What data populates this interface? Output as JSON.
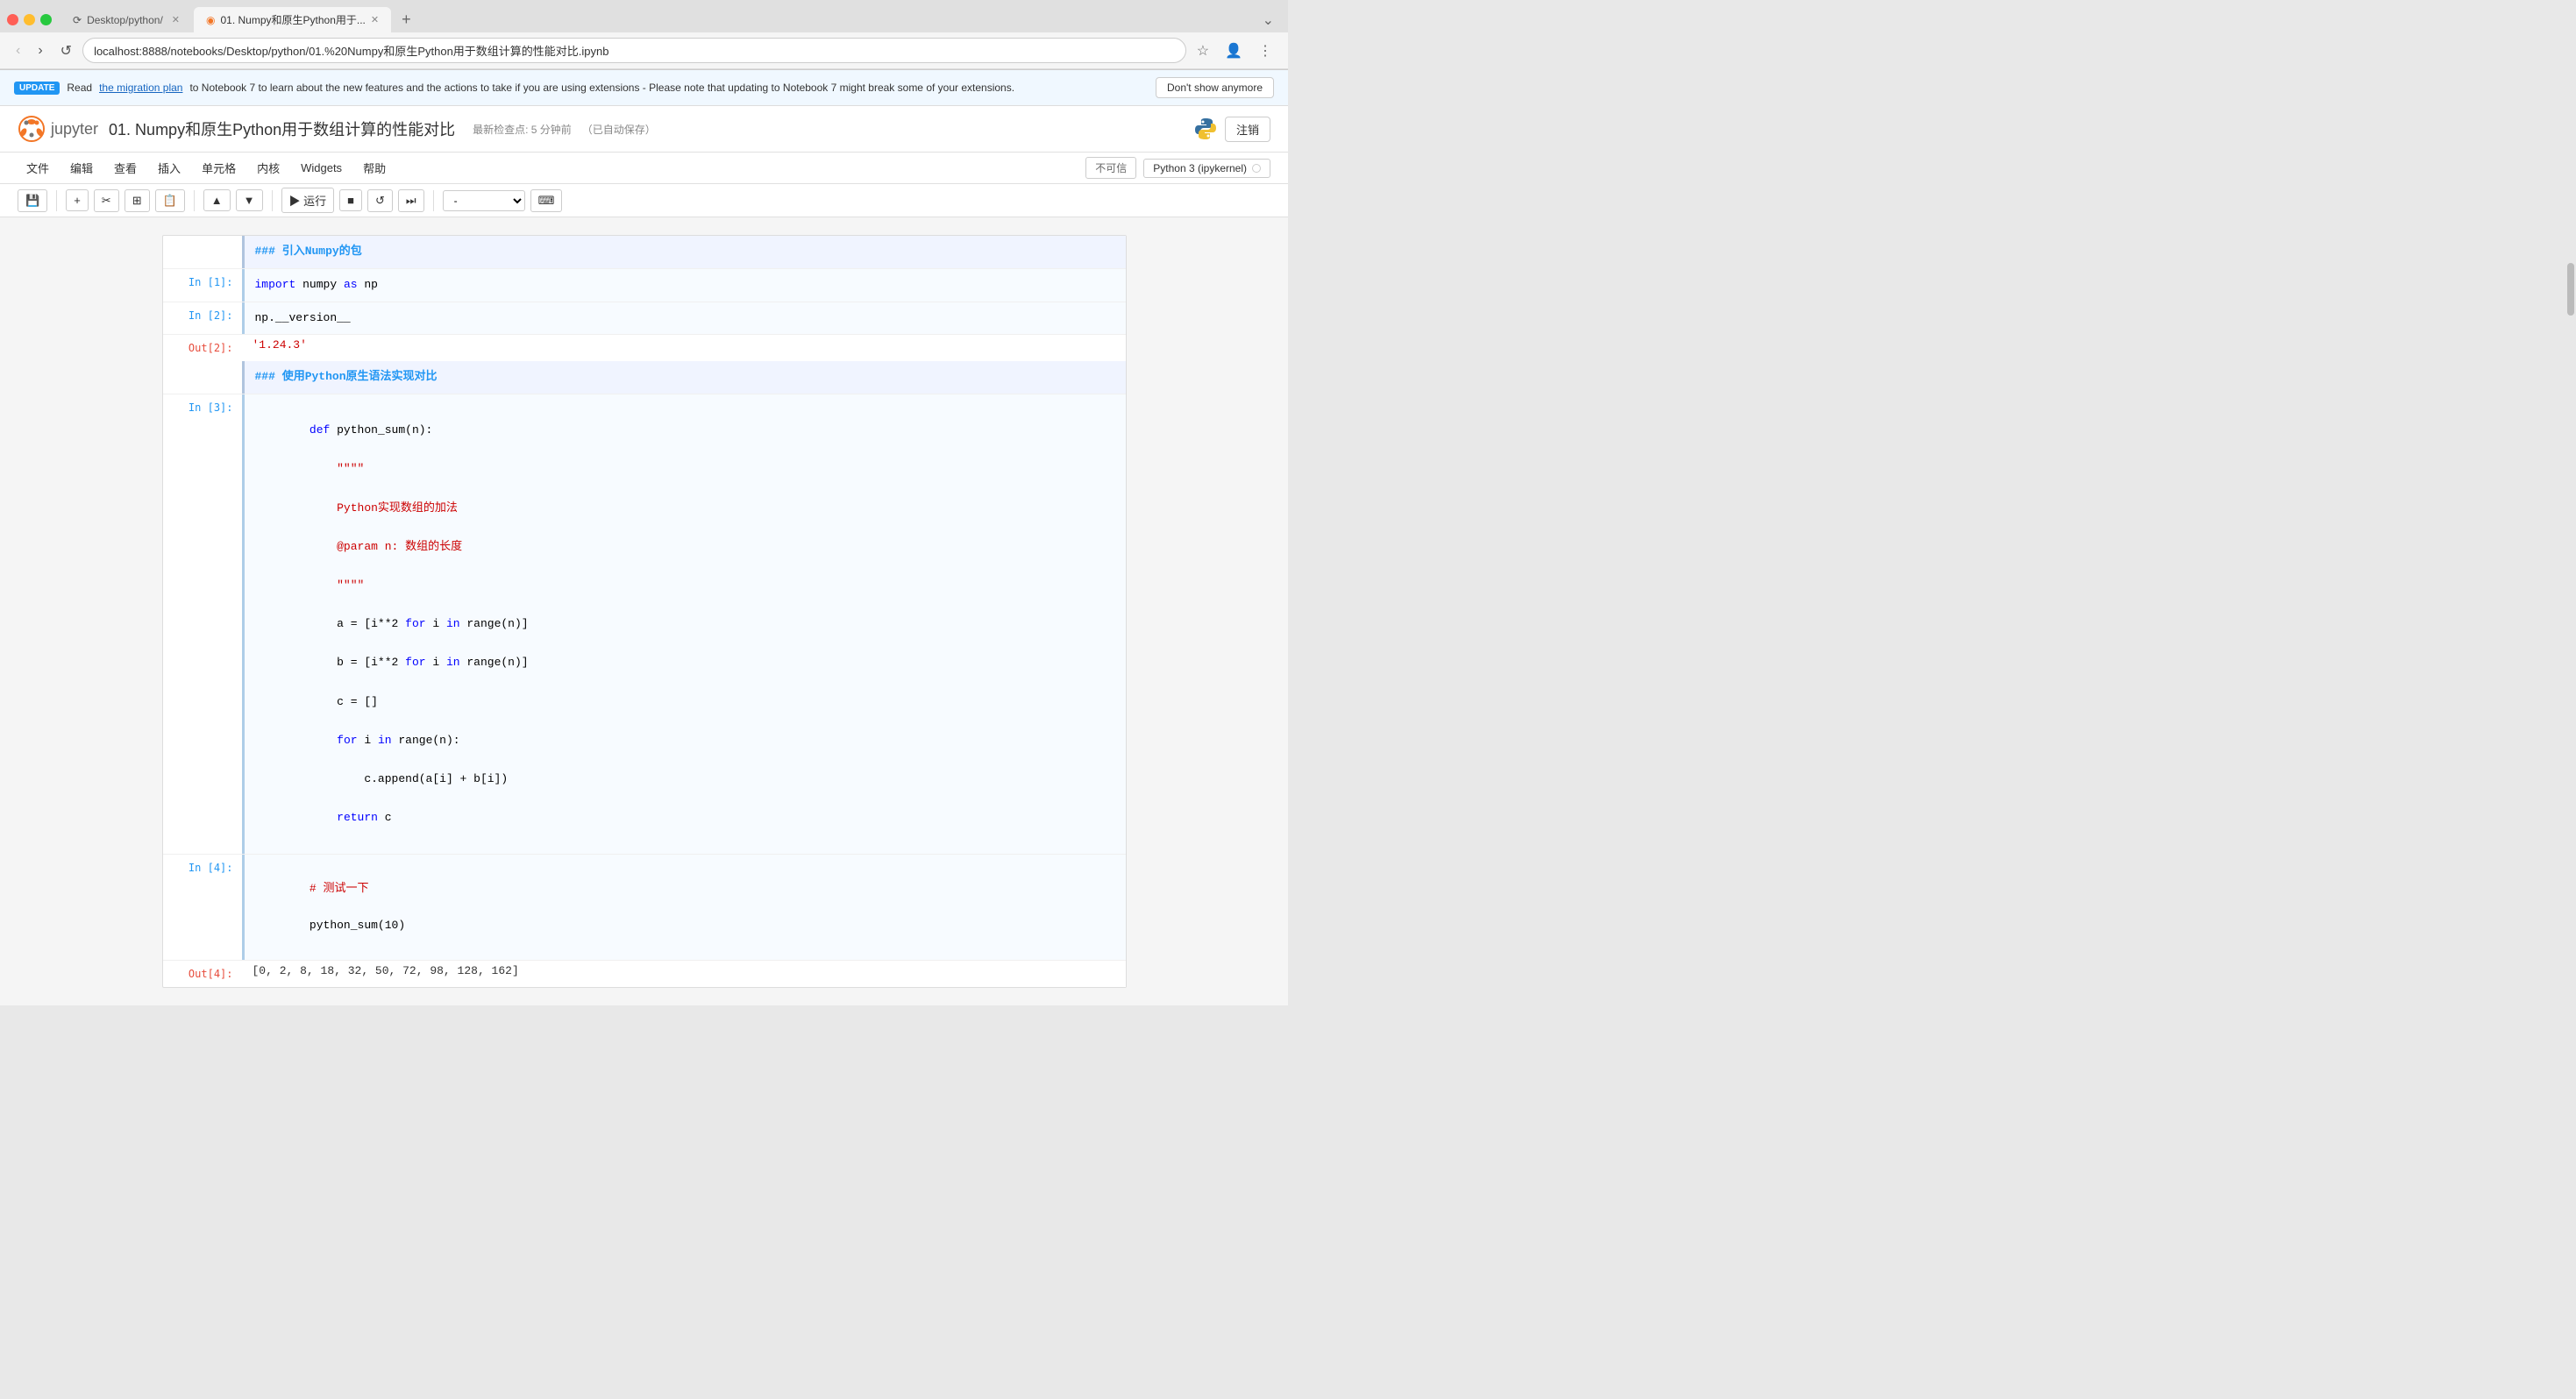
{
  "browser": {
    "tabs": [
      {
        "id": "tab1",
        "label": "Desktop/python/",
        "active": false,
        "loading": true
      },
      {
        "id": "tab2",
        "label": "01. Numpy和原生Python用于...",
        "active": true,
        "loading": false
      }
    ],
    "url": "localhost:8888/notebooks/Desktop/python/01.%20Numpy和原生Python用于数组计算的性能对比.ipynb",
    "new_tab_label": "+",
    "tab_list_label": "⌄"
  },
  "update_banner": {
    "badge": "UPDATE",
    "text_before_link": "Read ",
    "link_text": "the migration plan",
    "text_after": " to Notebook 7 to learn about the new features and the actions to take if you are using extensions - Please note that updating to Notebook 7 might break some of your extensions.",
    "dont_show_label": "Don't show anymore"
  },
  "jupyter": {
    "logo_text": "jupyter",
    "notebook_title": "01. Numpy和原生Python用于数组计算的性能对比",
    "checkpoint_label": "最新检查点: 5 分钟前",
    "autosave_label": "（已自动保存）",
    "logout_label": "注销"
  },
  "menu": {
    "items": [
      "文件",
      "编辑",
      "查看",
      "插入",
      "单元格",
      "内核",
      "Widgets",
      "帮助"
    ],
    "kernel_badge": "不可信",
    "kernel_name": "Python 3 (ipykernel)",
    "kernel_circle": "○"
  },
  "toolbar": {
    "save_icon": "💾",
    "add_icon": "+",
    "cut_icon": "✂",
    "copy_icon": "⊞",
    "paste_icon": "📋",
    "move_up_icon": "▲",
    "move_down_icon": "▼",
    "run_label": "▶ 运行",
    "stop_icon": "■",
    "restart_icon": "↺",
    "fast_forward_icon": "⏭",
    "cell_type": "-",
    "keyboard_icon": "⌨"
  },
  "cells": [
    {
      "type": "markdown",
      "label": "",
      "content": "### 引入Numpy的包"
    },
    {
      "type": "code",
      "in_label": "In [1]:",
      "out_label": "",
      "code_lines": [
        {
          "parts": [
            {
              "text": "import",
              "cls": "kw"
            },
            {
              "text": " numpy ",
              "cls": ""
            },
            {
              "text": "as",
              "cls": "kw"
            },
            {
              "text": " np",
              "cls": ""
            }
          ]
        }
      ],
      "output": null
    },
    {
      "type": "code",
      "in_label": "In [2]:",
      "out_label": "Out[2]:",
      "code_lines": [
        {
          "parts": [
            {
              "text": "np.__version__",
              "cls": ""
            }
          ]
        }
      ],
      "output": "'1.24.3'"
    },
    {
      "type": "markdown",
      "label": "",
      "content": "### 使用Python原生语法实现对比"
    },
    {
      "type": "code",
      "in_label": "In [3]:",
      "out_label": "",
      "code_lines": [
        {
          "parts": [
            {
              "text": "def",
              "cls": "kw"
            },
            {
              "text": " python_sum(n):",
              "cls": ""
            }
          ]
        },
        {
          "parts": [
            {
              "text": "    \"\"\"\"",
              "cls": "cmt"
            }
          ]
        },
        {
          "parts": [
            {
              "text": "    Python实现数组的加法",
              "cls": "cmt"
            }
          ]
        },
        {
          "parts": [
            {
              "text": "    @param n: 数组的长度",
              "cls": "cmt"
            }
          ]
        },
        {
          "parts": [
            {
              "text": "    \"\"\"\"",
              "cls": "cmt"
            }
          ]
        },
        {
          "parts": [
            {
              "text": "    a = [i**2 ",
              "cls": ""
            },
            {
              "text": "for",
              "cls": "kw"
            },
            {
              "text": " i ",
              "cls": ""
            },
            {
              "text": "in",
              "cls": "kw"
            },
            {
              "text": " range(n)]",
              "cls": ""
            }
          ]
        },
        {
          "parts": [
            {
              "text": "    b = [i**2 ",
              "cls": ""
            },
            {
              "text": "for",
              "cls": "kw"
            },
            {
              "text": " i ",
              "cls": ""
            },
            {
              "text": "in",
              "cls": "kw"
            },
            {
              "text": " range(n)]",
              "cls": ""
            }
          ]
        },
        {
          "parts": [
            {
              "text": "    c = []",
              "cls": ""
            }
          ]
        },
        {
          "parts": [
            {
              "text": "    ",
              "cls": ""
            },
            {
              "text": "for",
              "cls": "kw"
            },
            {
              "text": " i ",
              "cls": ""
            },
            {
              "text": "in",
              "cls": "kw"
            },
            {
              "text": " range(n):",
              "cls": ""
            }
          ]
        },
        {
          "parts": [
            {
              "text": "        c.append(a[i] + b[i])",
              "cls": ""
            }
          ]
        },
        {
          "parts": [
            {
              "text": "    ",
              "cls": ""
            },
            {
              "text": "return",
              "cls": "kw"
            },
            {
              "text": " c",
              "cls": ""
            }
          ]
        }
      ],
      "output": null
    },
    {
      "type": "code",
      "in_label": "In [4]:",
      "out_label": "Out[4]:",
      "code_lines": [
        {
          "parts": [
            {
              "text": "# 测试一下",
              "cls": "cmt"
            }
          ]
        },
        {
          "parts": [
            {
              "text": "python_sum(10)",
              "cls": ""
            }
          ]
        }
      ],
      "output": "[0, 2, 8, 18, 32, 50, 72, 98, 128, 162]"
    }
  ]
}
